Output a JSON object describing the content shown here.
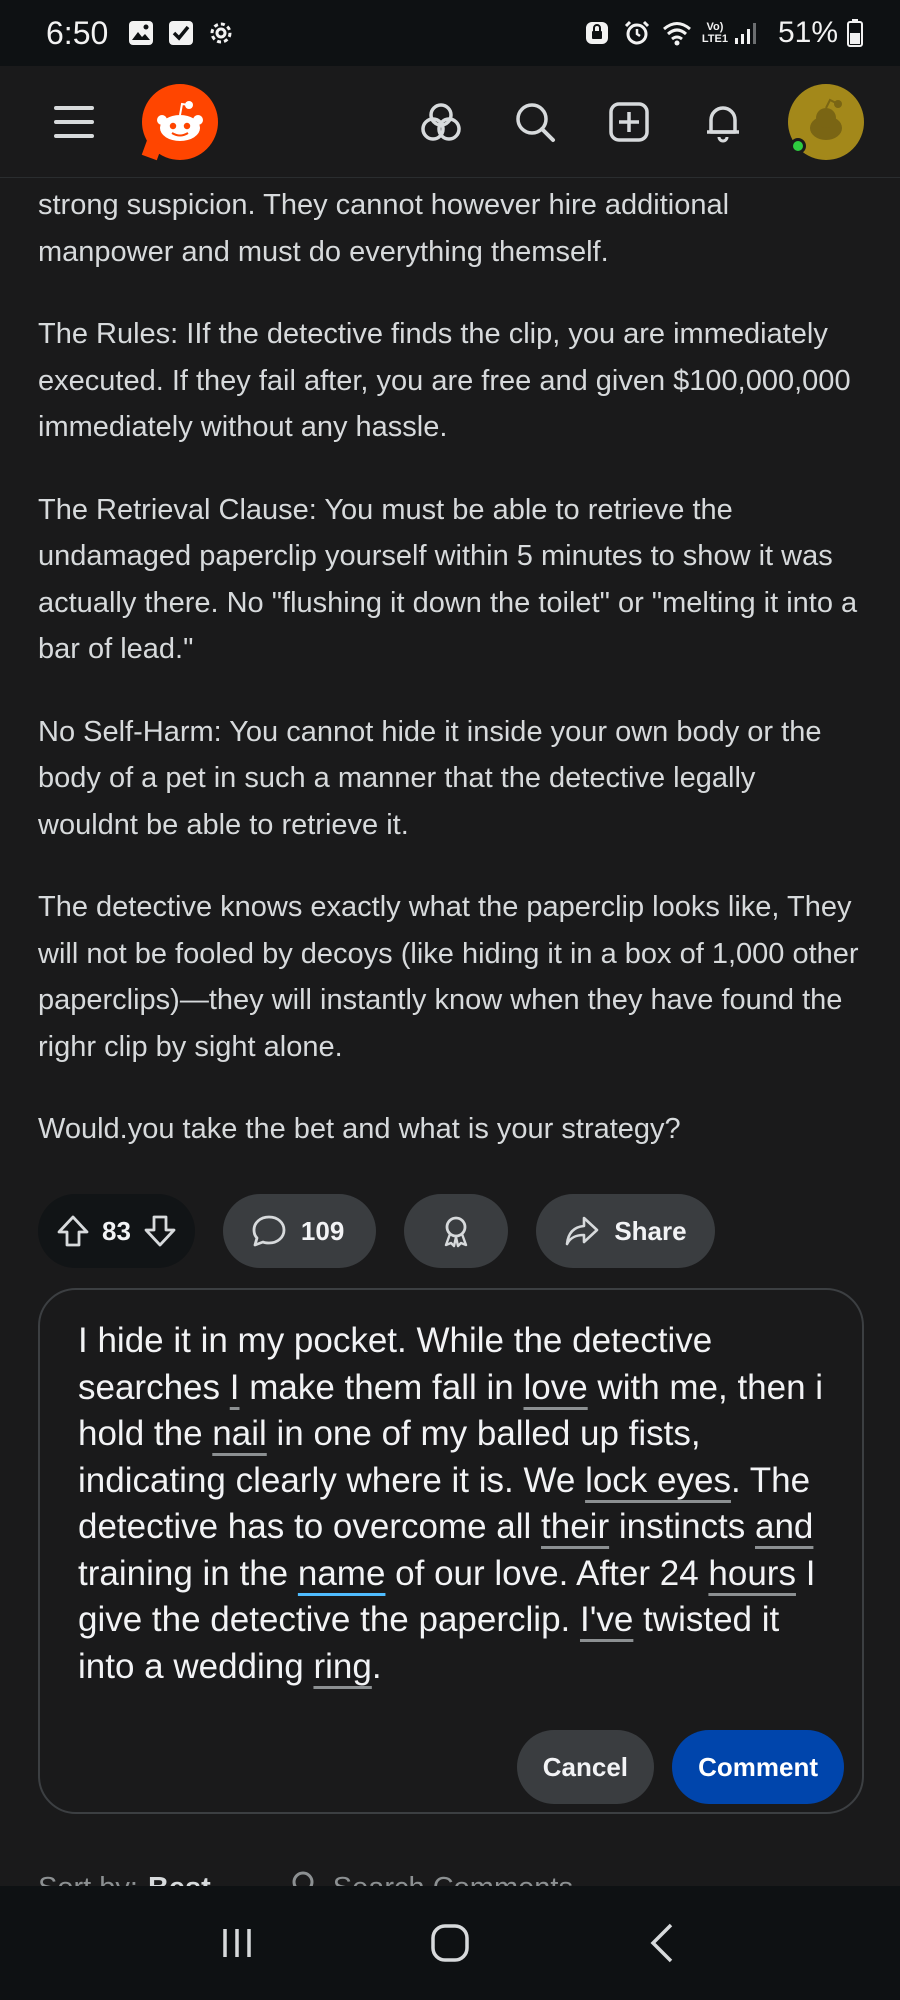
{
  "status_bar": {
    "time": "6:50",
    "network_label_top": "Vo)",
    "network_label_bottom": "LTE1",
    "battery": "51%"
  },
  "header": {
    "icons": [
      "menu-icon",
      "reddit-logo",
      "communities-icon",
      "search-icon",
      "create-post-icon",
      "notifications-icon",
      "avatar"
    ]
  },
  "post": {
    "paragraphs": [
      "strong suspicion. They cannot however hire additional manpower and must do everything themself.",
      "The Rules: IIf the detective finds the clip, you are immediately executed. If they fail after, you are free and given $100,000,000 immediately without any hassle.",
      "The Retrieval Clause: You must be able to retrieve the undamaged paperclip yourself within 5 minutes to show it was actually there. No \"flushing it down the toilet\" or \"melting it into a bar of lead.\"",
      "No Self-Harm: You cannot hide it inside your own body or the body of a pet in such a manner that the detective legally wouldnt be able to retrieve it.",
      "The detective knows exactly what the paperclip looks like, They will not be fooled by decoys (like hiding it in a box of 1,000 other paperclips)—they will instantly know when they have found the righr clip by sight alone.",
      "Would.you take the bet and what is your strategy?"
    ]
  },
  "actions": {
    "vote_count": "83",
    "comment_count": "109",
    "share_label": "Share"
  },
  "composer": {
    "segments": [
      {
        "t": "I hide it in my pocket. While the detective searches ",
        "u": ""
      },
      {
        "t": "I",
        "u": "gray"
      },
      {
        "t": " make them fall in ",
        "u": ""
      },
      {
        "t": "love",
        "u": "gray"
      },
      {
        "t": " with me, then i hold the ",
        "u": ""
      },
      {
        "t": "nail",
        "u": "gray"
      },
      {
        "t": " in one of my balled up fists, indicating clearly where it is. We ",
        "u": ""
      },
      {
        "t": "lock eyes",
        "u": "gray"
      },
      {
        "t": ". The detective has to overcome all ",
        "u": ""
      },
      {
        "t": "their",
        "u": "gray"
      },
      {
        "t": " instincts ",
        "u": ""
      },
      {
        "t": "and",
        "u": "gray"
      },
      {
        "t": " training in the ",
        "u": ""
      },
      {
        "t": "name",
        "u": "blue"
      },
      {
        "t": " of our love. After 24 ",
        "u": ""
      },
      {
        "t": "hours",
        "u": "gray"
      },
      {
        "t": " I give the detective the paperclip. ",
        "u": ""
      },
      {
        "t": "I've",
        "u": "gray"
      },
      {
        "t": " twisted it into a wedding ",
        "u": ""
      },
      {
        "t": "ring",
        "u": "gray"
      },
      {
        "t": ".",
        "u": ""
      }
    ],
    "cancel_label": "Cancel",
    "comment_label": "Comment"
  },
  "sort": {
    "label": "Sort by:",
    "value": "Best",
    "search_label": "Search Comments"
  },
  "colors": {
    "background": "#1a1a1b",
    "accent_blue": "#0045ac",
    "reddit_orange": "#ff4500",
    "pill_gray": "#3a3d40"
  }
}
